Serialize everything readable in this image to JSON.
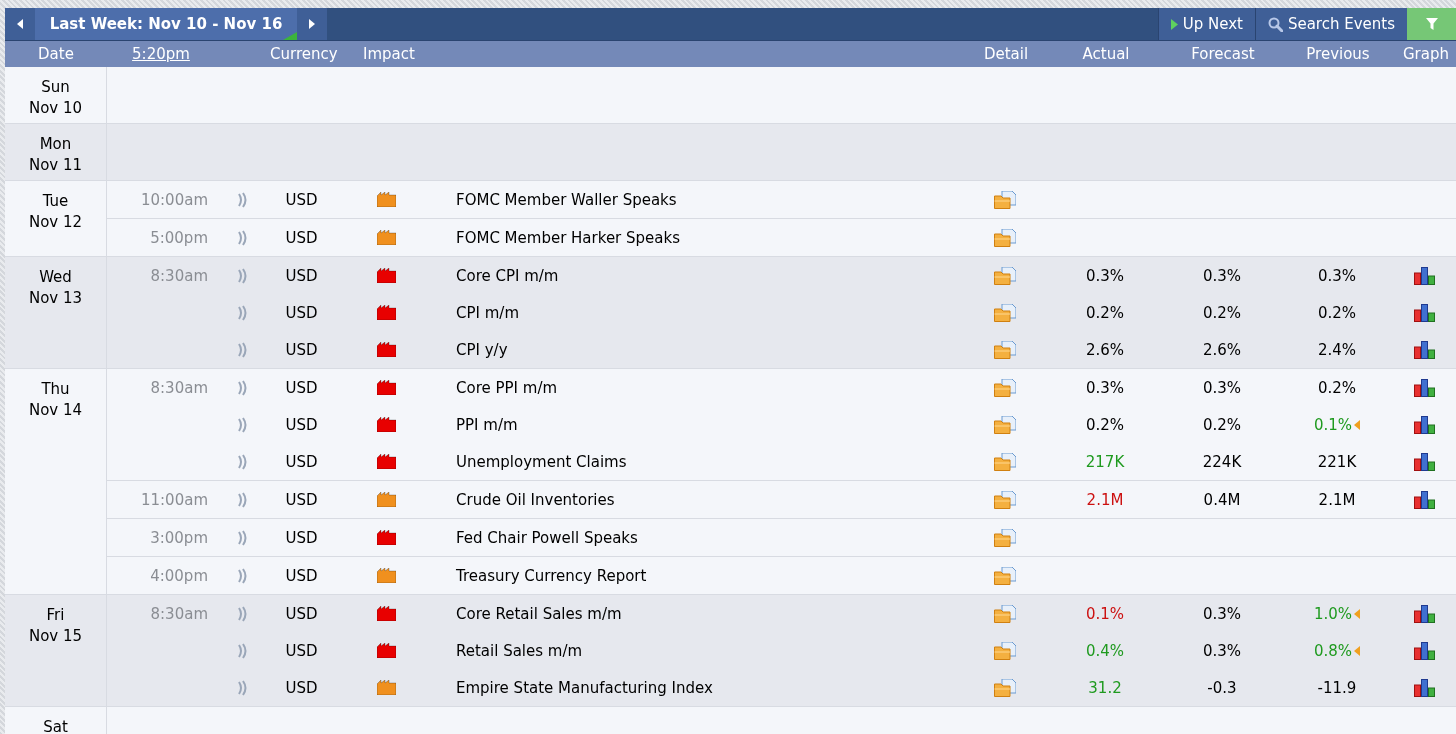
{
  "toolbar": {
    "week_title": "Last Week: Nov 10 - Nov 16",
    "up_next": "Up Next",
    "search": "Search Events"
  },
  "columns": {
    "date": "Date",
    "time": "5:20pm",
    "currency": "Currency",
    "impact": "Impact",
    "detail": "Detail",
    "actual": "Actual",
    "forecast": "Forecast",
    "previous": "Previous",
    "graph": "Graph"
  },
  "days": [
    {
      "weekday": "Sun",
      "date": "Nov 10"
    },
    {
      "weekday": "Mon",
      "date": "Nov 11"
    },
    {
      "weekday": "Tue",
      "date": "Nov 12",
      "events": [
        {
          "time": "10:00am",
          "currency": "USD",
          "color": "#f0901e",
          "title": "FOMC Member Waller Speaks",
          "graph": false
        },
        {
          "time": "5:00pm",
          "currency": "USD",
          "color": "#f0901e",
          "title": "FOMC Member Harker Speaks",
          "graph": false
        }
      ]
    },
    {
      "weekday": "Wed",
      "date": "Nov 13",
      "events": [
        {
          "time": "8:30am",
          "currency": "USD",
          "color": "#e80000",
          "title": "Core CPI m/m",
          "actual": "0.3%",
          "forecast": "0.3%",
          "previous": "0.3%",
          "graph": true
        },
        {
          "currency": "USD",
          "color": "#e80000",
          "title": "CPI m/m",
          "actual": "0.2%",
          "forecast": "0.2%",
          "previous": "0.2%",
          "graph": true
        },
        {
          "currency": "USD",
          "color": "#e80000",
          "title": "CPI y/y",
          "actual": "2.6%",
          "forecast": "2.6%",
          "previous": "2.4%",
          "graph": true
        }
      ]
    },
    {
      "weekday": "Thu",
      "date": "Nov 14",
      "events": [
        {
          "time": "8:30am",
          "currency": "USD",
          "color": "#e80000",
          "title": "Core PPI m/m",
          "actual": "0.3%",
          "forecast": "0.3%",
          "previous": "0.2%",
          "graph": true
        },
        {
          "currency": "USD",
          "color": "#e80000",
          "title": "PPI m/m",
          "actual": "0.2%",
          "forecast": "0.2%",
          "previous": "0.1%",
          "previous_better": true,
          "revised": true,
          "graph": true
        },
        {
          "currency": "USD",
          "color": "#e80000",
          "title": "Unemployment Claims",
          "actual": "217K",
          "actual_better": true,
          "forecast": "224K",
          "previous": "221K",
          "graph": true
        },
        {
          "time": "11:00am",
          "currency": "USD",
          "color": "#f0901e",
          "title": "Crude Oil Inventories",
          "actual": "2.1M",
          "actual_worse": true,
          "forecast": "0.4M",
          "previous": "2.1M",
          "graph": true
        },
        {
          "time": "3:00pm",
          "currency": "USD",
          "color": "#e80000",
          "title": "Fed Chair Powell Speaks",
          "graph": false
        },
        {
          "time": "4:00pm",
          "currency": "USD",
          "color": "#f0901e",
          "title": "Treasury Currency Report",
          "graph": false
        }
      ]
    },
    {
      "weekday": "Fri",
      "date": "Nov 15",
      "events": [
        {
          "time": "8:30am",
          "currency": "USD",
          "color": "#e80000",
          "title": "Core Retail Sales m/m",
          "actual": "0.1%",
          "actual_worse": true,
          "forecast": "0.3%",
          "previous": "1.0%",
          "previous_better": true,
          "revised": true,
          "graph": true
        },
        {
          "currency": "USD",
          "color": "#e80000",
          "title": "Retail Sales m/m",
          "actual": "0.4%",
          "actual_better": true,
          "forecast": "0.3%",
          "previous": "0.8%",
          "previous_better": true,
          "revised": true,
          "graph": true
        },
        {
          "currency": "USD",
          "color": "#f0901e",
          "title": "Empire State Manufacturing Index",
          "actual": "31.2",
          "actual_better": true,
          "forecast": "-0.3",
          "previous": "-11.9",
          "graph": true
        }
      ]
    },
    {
      "weekday": "Sat"
    }
  ]
}
